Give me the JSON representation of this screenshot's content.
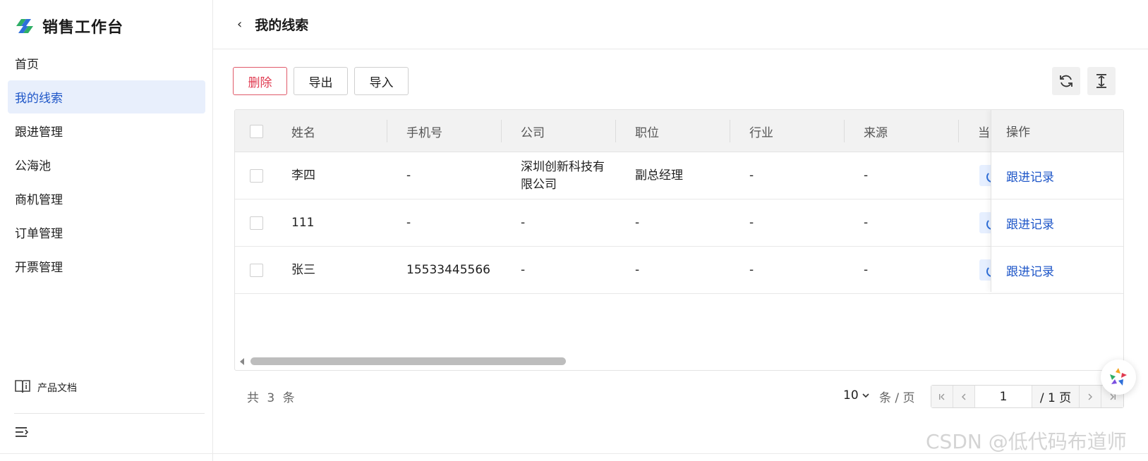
{
  "app": {
    "title": "销售工作台",
    "colors": {
      "accent": "#1e56c8",
      "danger": "#e0394f",
      "active_bg": "#e8effc"
    }
  },
  "sidebar": {
    "items": [
      {
        "label": "首页",
        "active": false
      },
      {
        "label": "我的线索",
        "active": true
      },
      {
        "label": "跟进管理",
        "active": false
      },
      {
        "label": "公海池",
        "active": false
      },
      {
        "label": "商机管理",
        "active": false
      },
      {
        "label": "订单管理",
        "active": false
      },
      {
        "label": "开票管理",
        "active": false
      }
    ],
    "docs_label": "产品文档",
    "docs_icon": "book-icon",
    "collapse_icon": "menu-collapse-icon"
  },
  "header": {
    "back_icon": "chevron-left-icon",
    "back_glyph": "‹",
    "title": "我的线索"
  },
  "toolbar": {
    "delete_label": "删除",
    "export_label": "导出",
    "import_label": "导入",
    "refresh_icon": "refresh-icon",
    "density_icon": "column-height-icon"
  },
  "table": {
    "columns": [
      "姓名",
      "手机号",
      "公司",
      "职位",
      "行业",
      "来源",
      "当",
      "操作"
    ],
    "rows": [
      {
        "name": "李四",
        "phone": "-",
        "company": "深圳创新科技有限公司",
        "position": "副总经理",
        "industry": "-",
        "source": "-",
        "action": "跟进记录"
      },
      {
        "name": "111",
        "phone": "-",
        "company": "-",
        "position": "-",
        "industry": "-",
        "source": "-",
        "action": "跟进记录"
      },
      {
        "name": "张三",
        "phone": "15533445566",
        "company": "-",
        "position": "-",
        "industry": "-",
        "source": "-",
        "action": "跟进记录"
      }
    ],
    "status_icon": "status-tag-icon"
  },
  "pagination": {
    "total_text": "共 3 条",
    "page_size": "10",
    "per_page_label": "条 / 页",
    "current_page": "1",
    "total_pages_text": "/ 1 页"
  },
  "watermark": "CSDN @低代码布道师"
}
